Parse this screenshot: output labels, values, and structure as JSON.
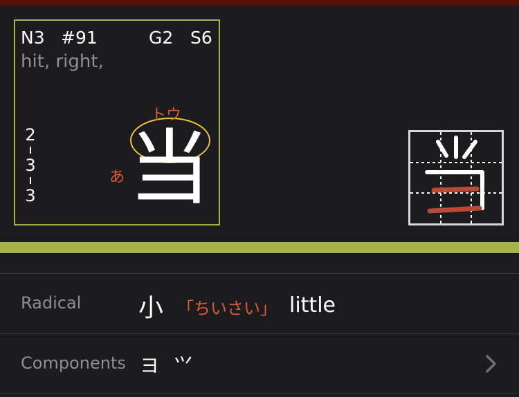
{
  "colors": {
    "top_strip": "#5a0f08",
    "card_border": "#a8b24a",
    "green_bar": "#a8b24a",
    "accent_red": "#e05a3a",
    "circle": "#f0c040",
    "stroke_highlight": "#b84a38"
  },
  "card": {
    "level": "N3",
    "number": "#91",
    "grade": "G2",
    "strokes": "S6",
    "meaning": "hit, right,",
    "kanji": "当",
    "on_reading": "トウ",
    "kun_marker": "あ",
    "stroke_order": [
      "2",
      "3",
      "3"
    ]
  },
  "stroke_diagram": {
    "kanji": "当",
    "highlight_strokes": 2
  },
  "radical": {
    "label": "Radical",
    "glyph": "小",
    "reading": "「ちいさい」",
    "meaning": "little"
  },
  "components": {
    "label": "Components",
    "glyphs": "ヨ ⺍",
    "chevron_icon": "chevron-right-icon"
  }
}
